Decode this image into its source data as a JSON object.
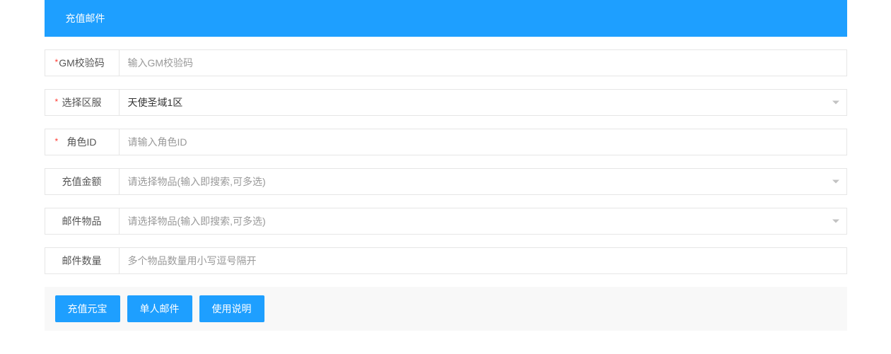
{
  "header": {
    "title": "充值邮件"
  },
  "form": {
    "gmCode": {
      "label": "GM校验码",
      "required": true,
      "placeholder": "输入GM校验码",
      "value": ""
    },
    "server": {
      "label": "选择区服",
      "required": true,
      "value": "天使圣域1区"
    },
    "roleId": {
      "label": "角色ID",
      "required": true,
      "placeholder": "请输入角色ID",
      "value": ""
    },
    "rechargeAmount": {
      "label": "充值金额",
      "required": false,
      "placeholder": "请选择物品(输入即搜索,可多选)",
      "value": ""
    },
    "mailItems": {
      "label": "邮件物品",
      "required": false,
      "placeholder": "请选择物品(输入即搜索,可多选)",
      "value": ""
    },
    "mailQuantity": {
      "label": "邮件数量",
      "required": false,
      "placeholder": "多个物品数量用小写逗号隔开",
      "value": ""
    }
  },
  "buttons": {
    "recharge": "充值元宝",
    "singleMail": "单人邮件",
    "instructions": "使用说明"
  }
}
